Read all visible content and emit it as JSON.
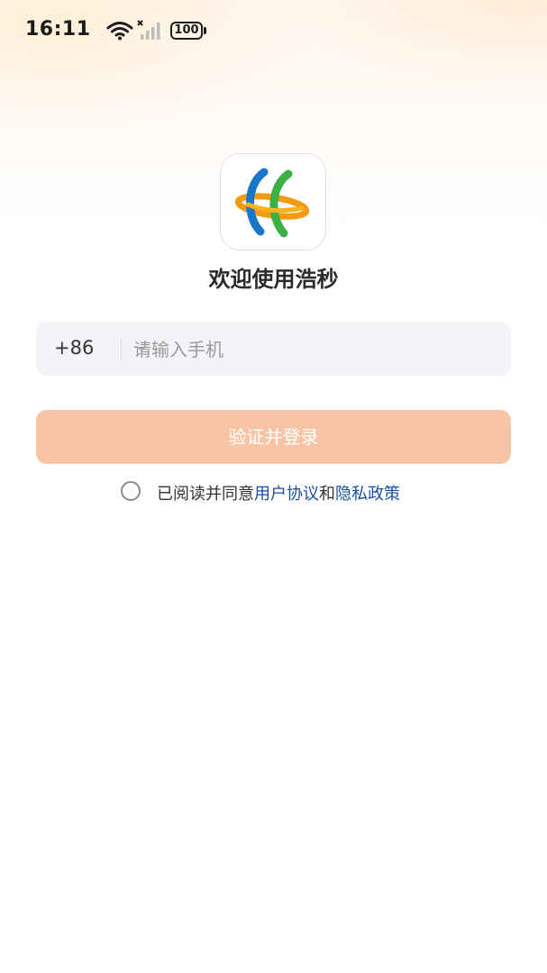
{
  "status_bar": {
    "time": "16:11",
    "wifi_icon": "wifi-icon",
    "signal_icon": "signal-icon",
    "battery_level": "100"
  },
  "brand": {
    "logo_icon": "app-logo-icon",
    "welcome": "欢迎使用浩秒"
  },
  "login_form": {
    "country_code": "+86",
    "phone_placeholder": "请输入手机",
    "phone_value": "",
    "submit_label": "验证并登录",
    "submit_color": "#f7c5a6"
  },
  "agreement": {
    "checked": false,
    "prefix": "已阅读并同意",
    "user_agreement": "用户协议",
    "conjunction": "和",
    "privacy_policy": "隐私政策",
    "link_color": "#1a4fa3"
  }
}
